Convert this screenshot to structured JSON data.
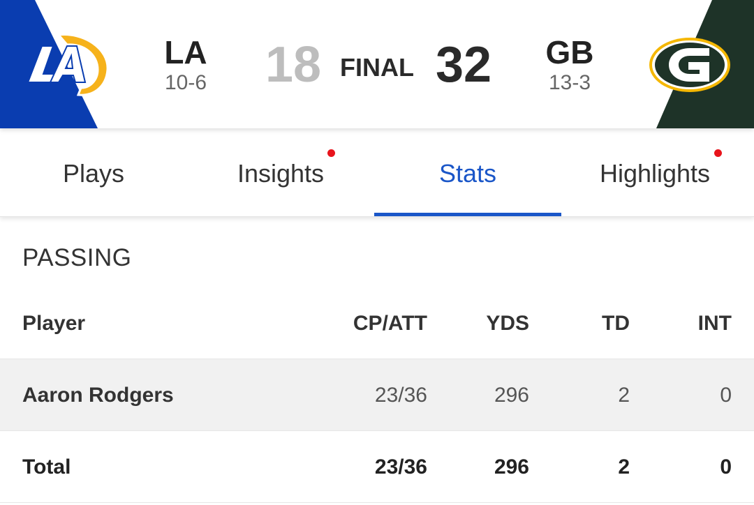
{
  "game": {
    "away": {
      "abbr": "LA",
      "record": "10-6",
      "score": "18",
      "color": "#0a3db0",
      "logo_text": "LA"
    },
    "home": {
      "abbr": "GB",
      "record": "13-3",
      "score": "32",
      "color": "#1e3328",
      "logo_text": "G"
    },
    "status": "FINAL"
  },
  "tabs": [
    {
      "label": "Plays",
      "active": false,
      "has_dot": false
    },
    {
      "label": "Insights",
      "active": false,
      "has_dot": true
    },
    {
      "label": "Stats",
      "active": true,
      "has_dot": false
    },
    {
      "label": "Highlights",
      "active": false,
      "has_dot": true
    }
  ],
  "passing": {
    "title": "PASSING",
    "columns": [
      "Player",
      "CP/ATT",
      "YDS",
      "TD",
      "INT"
    ],
    "rows": [
      {
        "player": "Aaron Rodgers",
        "cp_att": "23/36",
        "yds": "296",
        "td": "2",
        "int": "0"
      }
    ],
    "total": {
      "player": "Total",
      "cp_att": "23/36",
      "yds": "296",
      "td": "2",
      "int": "0"
    }
  },
  "colors": {
    "accent": "#1a56c8",
    "notification_dot": "#e8141c",
    "rams_gold": "#f6b21b",
    "packers_gold": "#f5b700"
  },
  "icons": [
    "rams-logo-icon",
    "packers-logo-icon",
    "notification-dot-icon"
  ]
}
